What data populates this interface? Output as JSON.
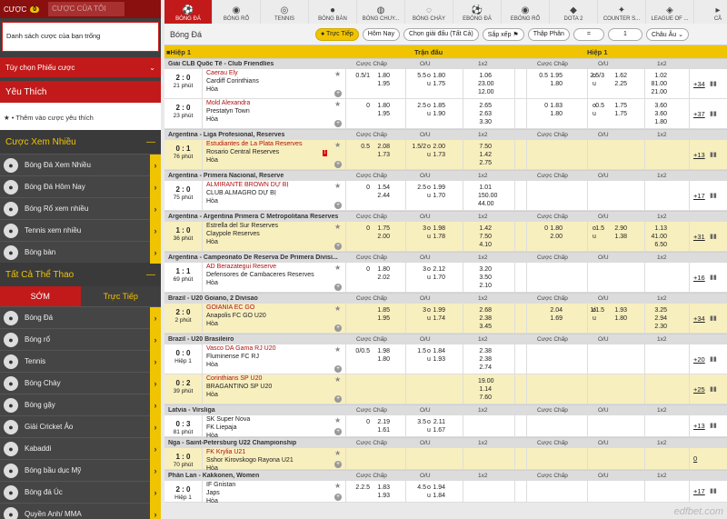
{
  "sidebar": {
    "tab_active": "CƯỢC",
    "badge": "0",
    "tab_inactive": "CƯỢC CỦA TÔI",
    "bet_empty": "Danh sách cược của bạn trống",
    "bet_options": "Tùy chọn Phiếu cược",
    "favorites": "Yêu Thích",
    "favorites_add": "Thêm vào cược yêu thích",
    "popular_title": "Cược Xem Nhiều",
    "popular": [
      "Bóng Đá Xem Nhiều",
      "Bóng Đá Hôm Nay",
      "Bóng Rổ xem nhiều",
      "Tennis xem nhiều",
      "Bóng bàn"
    ],
    "all_title": "Tất Cả Thể Thao",
    "split_early": "SỚM",
    "split_live": "Trực Tiếp",
    "sports": [
      "Bóng Đá",
      "Bóng rổ",
      "Tennis",
      "Bóng Chày",
      "Bóng gậy",
      "Giải Cricket Ảo",
      "Kabaddi",
      "Bóng bầu dục Mỹ",
      "Bóng đá Úc",
      "Quyền Anh/ MMA"
    ]
  },
  "sports_bar": [
    {
      "label": "BÓNG ĐÁ",
      "icon": "soccer-icon",
      "active": true
    },
    {
      "label": "BÓNG RỔ",
      "icon": "basketball-icon"
    },
    {
      "label": "TENNIS",
      "icon": "tennis-icon"
    },
    {
      "label": "BÓNG BÀN",
      "icon": "table-tennis-icon"
    },
    {
      "label": "BÓNG CHUY...",
      "icon": "volleyball-icon"
    },
    {
      "label": "BÓNG CHÀY",
      "icon": "baseball-icon"
    },
    {
      "label": "EBÓNG ĐÁ",
      "icon": "esoccer-icon"
    },
    {
      "label": "EBÓNG RỔ",
      "icon": "ebasketball-icon"
    },
    {
      "label": "DOTA 2",
      "icon": "dota-icon"
    },
    {
      "label": "COUNTER S...",
      "icon": "counter-strike-icon"
    },
    {
      "label": "LEAGUE OF ...",
      "icon": "lol-icon"
    },
    {
      "label": "CẦ",
      "icon": "more-icon"
    }
  ],
  "filter": {
    "title": "Bóng Đá",
    "live": "Trực Tiếp",
    "today": "Hôm Nay",
    "choose": "Chọn giải đấu (Tất Cả)",
    "sort": "Sắp xếp",
    "decimal": "Thập Phân",
    "eq": "=",
    "one": "1",
    "region": "Châu Âu"
  },
  "table_header": {
    "half": "Hiệp 1",
    "full": "Trận đấu",
    "half_right": "Hiệp 1"
  },
  "col_labels": {
    "hdp": "Cược Chấp",
    "ou": "O/U",
    "x12": "1x2"
  },
  "leagues": [
    {
      "name": "Giải CLB Quốc Tế - Club Friendlies",
      "matches": [
        {
          "score": "2 : 0",
          "time": "21 phút",
          "home": "Caerau Ely",
          "away": "Cardiff Corinthians",
          "hl": false,
          "fav": true,
          "fhl": "0.5/1",
          "fh1": "1.80",
          "fh2": "1.95",
          "ful": "5.5",
          "fou_o": "1.80",
          "fou_u": "1.75",
          "f1": "1.06",
          "f2": "23.00",
          "fx": "12.00",
          "hhl": "0.5",
          "hh1": "1.95",
          "hh2": "1.80",
          "hul": "2.5/3",
          "hou_o": "1.62",
          "hou_u": "2.25",
          "h1": "1.02",
          "h2": "81.00",
          "hx": "21.00",
          "more": "+34"
        },
        {
          "score": "2 : 0",
          "time": "23 phút",
          "home": "Mold Alexandra",
          "away": "Prestatyn Town",
          "hl": false,
          "fav": true,
          "fhl": "0",
          "fh1": "1.80",
          "fh2": "1.95",
          "ful": "2.5",
          "fou_o": "1.85",
          "fou_u": "1.90",
          "f1": "2.65",
          "f2": "2.63",
          "fx": "3.30",
          "hhl": "0",
          "hh1": "1.83",
          "hh2": "1.80",
          "hul": "0.5",
          "hou_o": "1.75",
          "hou_u": "1.75",
          "h1": "3.60",
          "h2": "3.60",
          "hx": "1.80",
          "more": "+37"
        }
      ]
    },
    {
      "name": "Argentina - Liga Profesional, Reserves",
      "matches": [
        {
          "score": "0 : 1",
          "time": "76 phút",
          "home": "Estudiantes de La Plata Reserves",
          "away": "Rosario Central Reserves",
          "hl": true,
          "fav": true,
          "red": "1",
          "fhl": "0.5",
          "fh1": "2.08",
          "fh2": "1.73",
          "ful": "1.5/2",
          "fou_o": "2.00",
          "fou_u": "1.73",
          "f1": "7.50",
          "f2": "1.42",
          "fx": "2.75",
          "more": "+13"
        }
      ]
    },
    {
      "name": "Argentina - Primera Nacional, Reserve",
      "matches": [
        {
          "score": "2 : 0",
          "time": "75 phút",
          "home": "ALMIRANTE BROWN DỰ BỊ",
          "away": "CLUB ALMAGRO DỰ BỊ",
          "hl": false,
          "fav": true,
          "fhl": "0",
          "fh1": "1.54",
          "fh2": "2.44",
          "ful": "2.5",
          "fou_o": "1.99",
          "fou_u": "1.70",
          "f1": "1.01",
          "f2": "150.00",
          "fx": "44.00",
          "more": "+17"
        }
      ]
    },
    {
      "name": "Argentina - Argentina Primera C Metropolitana Reserves",
      "matches": [
        {
          "score": "1 : 0",
          "time": "36 phút",
          "home": "Estrella del Sur Reserves",
          "away": "Claypole Reserves",
          "hl": true,
          "fav": false,
          "fhl": "0",
          "fh1": "1.75",
          "fh2": "2.00",
          "ful": "3",
          "fou_o": "1.98",
          "fou_u": "1.78",
          "f1": "1.42",
          "f2": "7.50",
          "fx": "4.10",
          "hhl": "0",
          "hh1": "1.80",
          "hh2": "2.00",
          "hul": "1.5",
          "hou_o": "2.90",
          "hou_u": "1.38",
          "h1": "1.13",
          "h2": "41.00",
          "hx": "6.50",
          "more": "+31"
        }
      ]
    },
    {
      "name": "Argentina - Campeonato De Reserva De Primera Divisi...",
      "matches": [
        {
          "score": "1 : 1",
          "time": "69 phút",
          "home": "AD Berazategui Reserve",
          "away": "Defensores de Cambaceres Reserves",
          "hl": false,
          "fav": true,
          "fhl": "0",
          "fh1": "1.80",
          "fh2": "2.02",
          "ful": "3",
          "fou_o": "2.12",
          "fou_u": "1.70",
          "f1": "3.20",
          "f2": "3.50",
          "fx": "2.10",
          "more": "+16"
        }
      ]
    },
    {
      "name": "Brazil - U20 Goiano, 2 Divisao",
      "matches": [
        {
          "score": "2 : 0",
          "time": "2 phút",
          "home": "GOIANIA EC GO",
          "away": "Anapolis FC GO U20",
          "hl": true,
          "fav": true,
          "fhl": "",
          "fh1": "1.85",
          "fh2": "1.95",
          "ful": "3",
          "fou_o": "1.99",
          "fou_u": "1.74",
          "f1": "2.68",
          "f2": "2.38",
          "fx": "3.45",
          "hhl": "",
          "hh1": "2.04",
          "hh2": "1.69",
          "hul": "1/1.5",
          "hou_o": "1.93",
          "hou_u": "1.80",
          "h1": "3.25",
          "h2": "2.94",
          "hx": "2.30",
          "more": "+34"
        }
      ]
    },
    {
      "name": "Brazil - U20 Brasileiro",
      "matches": [
        {
          "score": "0 : 0",
          "time": "Hiệp 1",
          "home": "Vasco DA Gama RJ U20",
          "away": "Fluminense FC RJ",
          "hl": false,
          "fav": true,
          "fhl": "0/0.5",
          "fh1": "1.98",
          "fh2": "1.80",
          "ful": "1.5",
          "fou_o": "1.84",
          "fou_u": "1.93",
          "f1": "2.38",
          "f2": "2.38",
          "fx": "2.74",
          "more": "+20"
        },
        {
          "score": "0 : 2",
          "time": "39 phút",
          "home": "Corinthians SP U20",
          "away": "BRAGANTINO SP U20",
          "hl": true,
          "fav": true,
          "f1": "19.00",
          "f2": "1.14",
          "fx": "7.60",
          "more": "+25"
        }
      ]
    },
    {
      "name": "Latvia - Virsliga",
      "matches": [
        {
          "score": "0 : 3",
          "time": "81 phút",
          "home": "SK Super Nova",
          "away": "FK Liepaja",
          "hl": false,
          "fav": false,
          "fhl": "0",
          "fh1": "2.19",
          "fh2": "1.61",
          "ful": "3.5",
          "fou_o": "2.11",
          "fou_u": "1.67",
          "more": "+13"
        }
      ]
    },
    {
      "name": "Nga - Saint-Petersburg U22 Championship",
      "matches": [
        {
          "score": "1 : 0",
          "time": "70 phút",
          "home": "FK Krylia U21",
          "away": "Sshor Kirovskogo Rayona U21",
          "hl": true,
          "fav": true,
          "more": "0"
        }
      ]
    },
    {
      "name": "Phần Lan - Kakkonen, Women",
      "matches": [
        {
          "score": "2 : 0",
          "time": "Hiệp 1",
          "home": "IF Gnistan",
          "away": "Japs",
          "hl": false,
          "fav": false,
          "fhl": "2.2.5",
          "fh1": "1.83",
          "fh2": "1.93",
          "ful": "4.5",
          "fou_o": "1.94",
          "fou_u": "1.84",
          "more": "+17"
        }
      ]
    }
  ],
  "draw_label": "Hòa",
  "watermark": "edfbet.com"
}
